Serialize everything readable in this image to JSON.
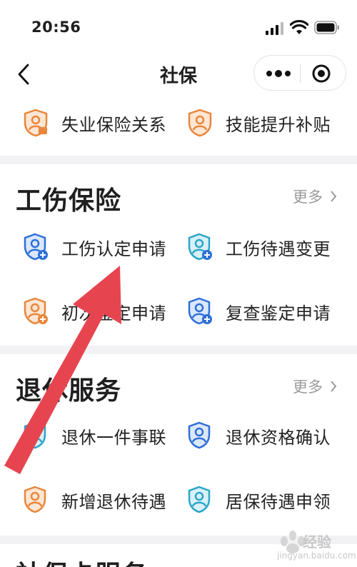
{
  "status": {
    "time": "20:56"
  },
  "nav": {
    "title": "社保"
  },
  "top_row": [
    {
      "label": "失业保险关系",
      "icon": "orange-shield-user-icon"
    },
    {
      "label": "技能提升补贴",
      "icon": "orange-shield-user-icon"
    }
  ],
  "sections": [
    {
      "title": "工伤保险",
      "more": "更多",
      "items": [
        {
          "label": "工伤认定申请",
          "icon": "blue-shield-user-add-icon"
        },
        {
          "label": "工伤待遇变更",
          "icon": "teal-shield-user-add-icon"
        },
        {
          "label": "初次鉴定申请",
          "icon": "orange-shield-user-add-icon"
        },
        {
          "label": "复查鉴定申请",
          "icon": "blue-shield-user-add-icon"
        }
      ]
    },
    {
      "title": "退休服务",
      "more": "更多",
      "items": [
        {
          "label": "退休一件事联",
          "icon": "teal-shield-user-icon"
        },
        {
          "label": "退休资格确认",
          "icon": "blue-shield-user-icon"
        },
        {
          "label": "新增退休待遇",
          "icon": "orange-shield-user-icon"
        },
        {
          "label": "居保待遇申领",
          "icon": "teal-shield-user-icon"
        }
      ]
    }
  ],
  "bottom_section": {
    "title": "社保卡服务"
  },
  "watermark": {
    "brand": "经验",
    "url": "jingyan.baidu.com"
  },
  "colors": {
    "orange": "#e8873c",
    "blue": "#2e6fd8",
    "teal": "#2aa6c8",
    "arrow": "#e64550"
  }
}
